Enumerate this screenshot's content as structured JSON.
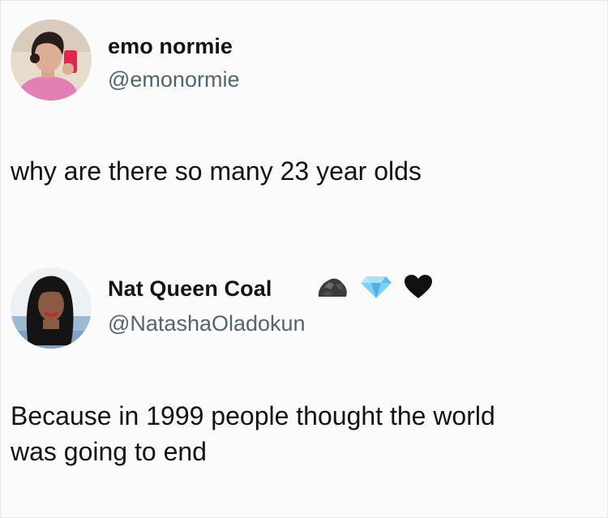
{
  "tweets": [
    {
      "display_name": "emo normie",
      "handle": "@emonormie",
      "text": "why are there so many 23 year olds"
    },
    {
      "display_name": "Nat Queen Coal",
      "handle": "@NatashaOladokun",
      "badges": [
        "coal-icon",
        "diamond-icon",
        "black-heart-icon"
      ],
      "text_line1": "Because in 1999 people thought the world",
      "text_line2": "was going to end"
    }
  ],
  "colors": {
    "text": "#0f1419",
    "secondary_text": "#536471",
    "background": "#ffffff"
  }
}
